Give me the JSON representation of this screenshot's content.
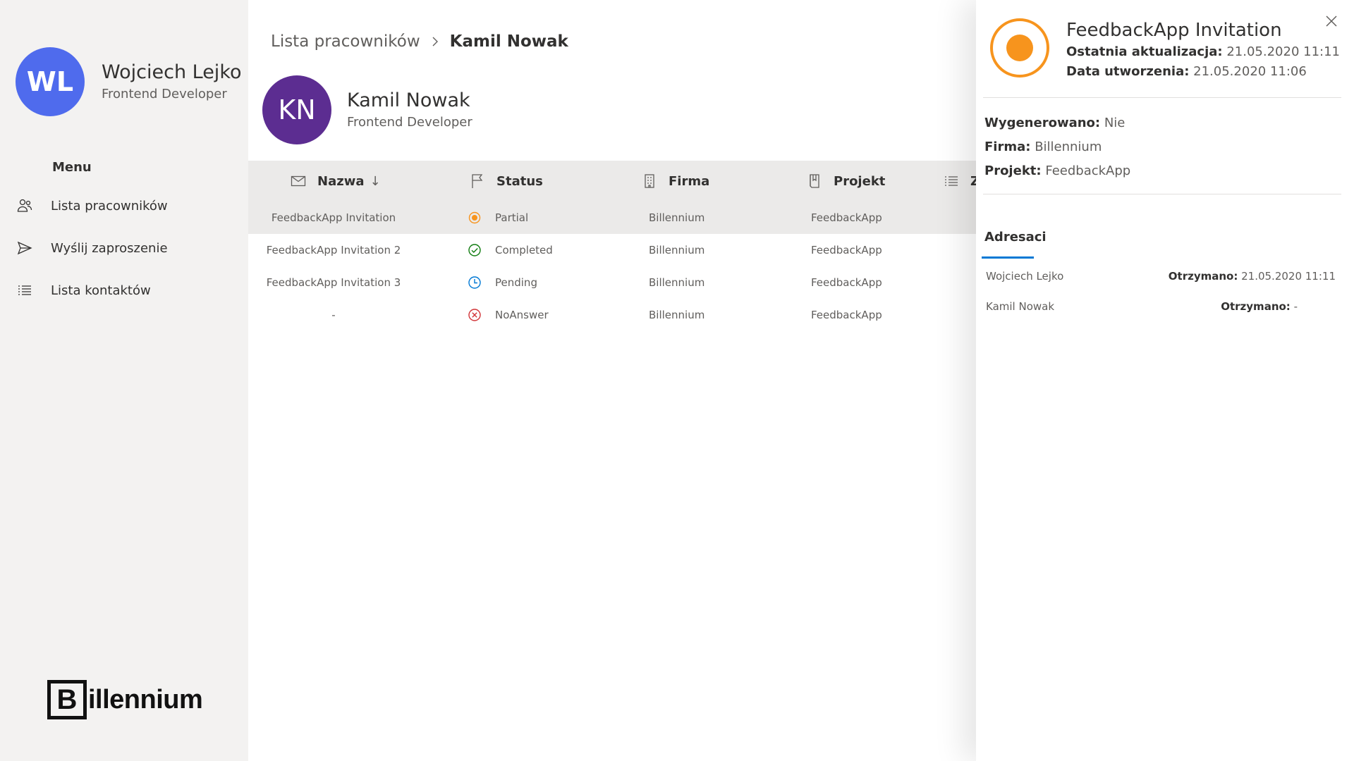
{
  "sidebar": {
    "user": {
      "initials": "WL",
      "name": "Wojciech Lejko",
      "role": "Frontend Developer"
    },
    "menu_title": "Menu",
    "items": [
      {
        "label": "Lista pracowników",
        "icon": "people-icon"
      },
      {
        "label": "Wyślij zaproszenie",
        "icon": "send-icon"
      },
      {
        "label": "Lista kontaktów",
        "icon": "list-icon"
      }
    ],
    "logo": {
      "mark": "B",
      "rest": "illennium"
    }
  },
  "main": {
    "breadcrumb": {
      "parent": "Lista pracowników",
      "current": "Kamil Nowak"
    },
    "person": {
      "initials": "KN",
      "name": "Kamil Nowak",
      "role": "Frontend Developer"
    },
    "columns": [
      {
        "label": "Nazwa",
        "icon": "mail-icon",
        "sort": "↓"
      },
      {
        "label": "Status",
        "icon": "flag-icon"
      },
      {
        "label": "Firma",
        "icon": "building-icon"
      },
      {
        "label": "Projekt",
        "icon": "book-icon"
      },
      {
        "label": "Z",
        "icon": "list-icon"
      }
    ],
    "rows": [
      {
        "name": "FeedbackApp Invitation",
        "status": "Partial",
        "status_icon": "partial-icon",
        "firma": "Billennium",
        "projekt": "FeedbackApp",
        "selected": true
      },
      {
        "name": "FeedbackApp Invitation 2",
        "status": "Completed",
        "status_icon": "check-circle-icon",
        "firma": "Billennium",
        "projekt": "FeedbackApp"
      },
      {
        "name": "FeedbackApp Invitation 3",
        "status": "Pending",
        "status_icon": "clock-icon",
        "firma": "Billennium",
        "projekt": "FeedbackApp"
      },
      {
        "name": "-",
        "status": "NoAnswer",
        "status_icon": "x-circle-icon",
        "firma": "Billennium",
        "projekt": "FeedbackApp"
      }
    ]
  },
  "panel": {
    "title": "FeedbackApp Invitation",
    "updated_label": "Ostatnia aktualizacja:",
    "updated_value": "21.05.2020 11:11",
    "created_label": "Data utworzenia:",
    "created_value": "21.05.2020 11:06",
    "props": [
      {
        "label": "Wygenerowano:",
        "value": "Nie"
      },
      {
        "label": "Firma:",
        "value": "Billennium"
      },
      {
        "label": "Projekt:",
        "value": "FeedbackApp"
      }
    ],
    "tab": "Adresaci",
    "recipients": [
      {
        "name": "Wojciech Lejko",
        "received_label": "Otrzymano:",
        "received_value": "21.05.2020 11:11"
      },
      {
        "name": "Kamil Nowak",
        "received_label": "Otrzymano:",
        "received_value": "-"
      }
    ]
  },
  "colors": {
    "accent": "#0078d4",
    "partial": "#f7941d",
    "completed": "#107c10",
    "pending": "#0078d4",
    "noanswer": "#d13438",
    "avatar_wl": "#4f6bed",
    "avatar_kn": "#5c2d91"
  }
}
